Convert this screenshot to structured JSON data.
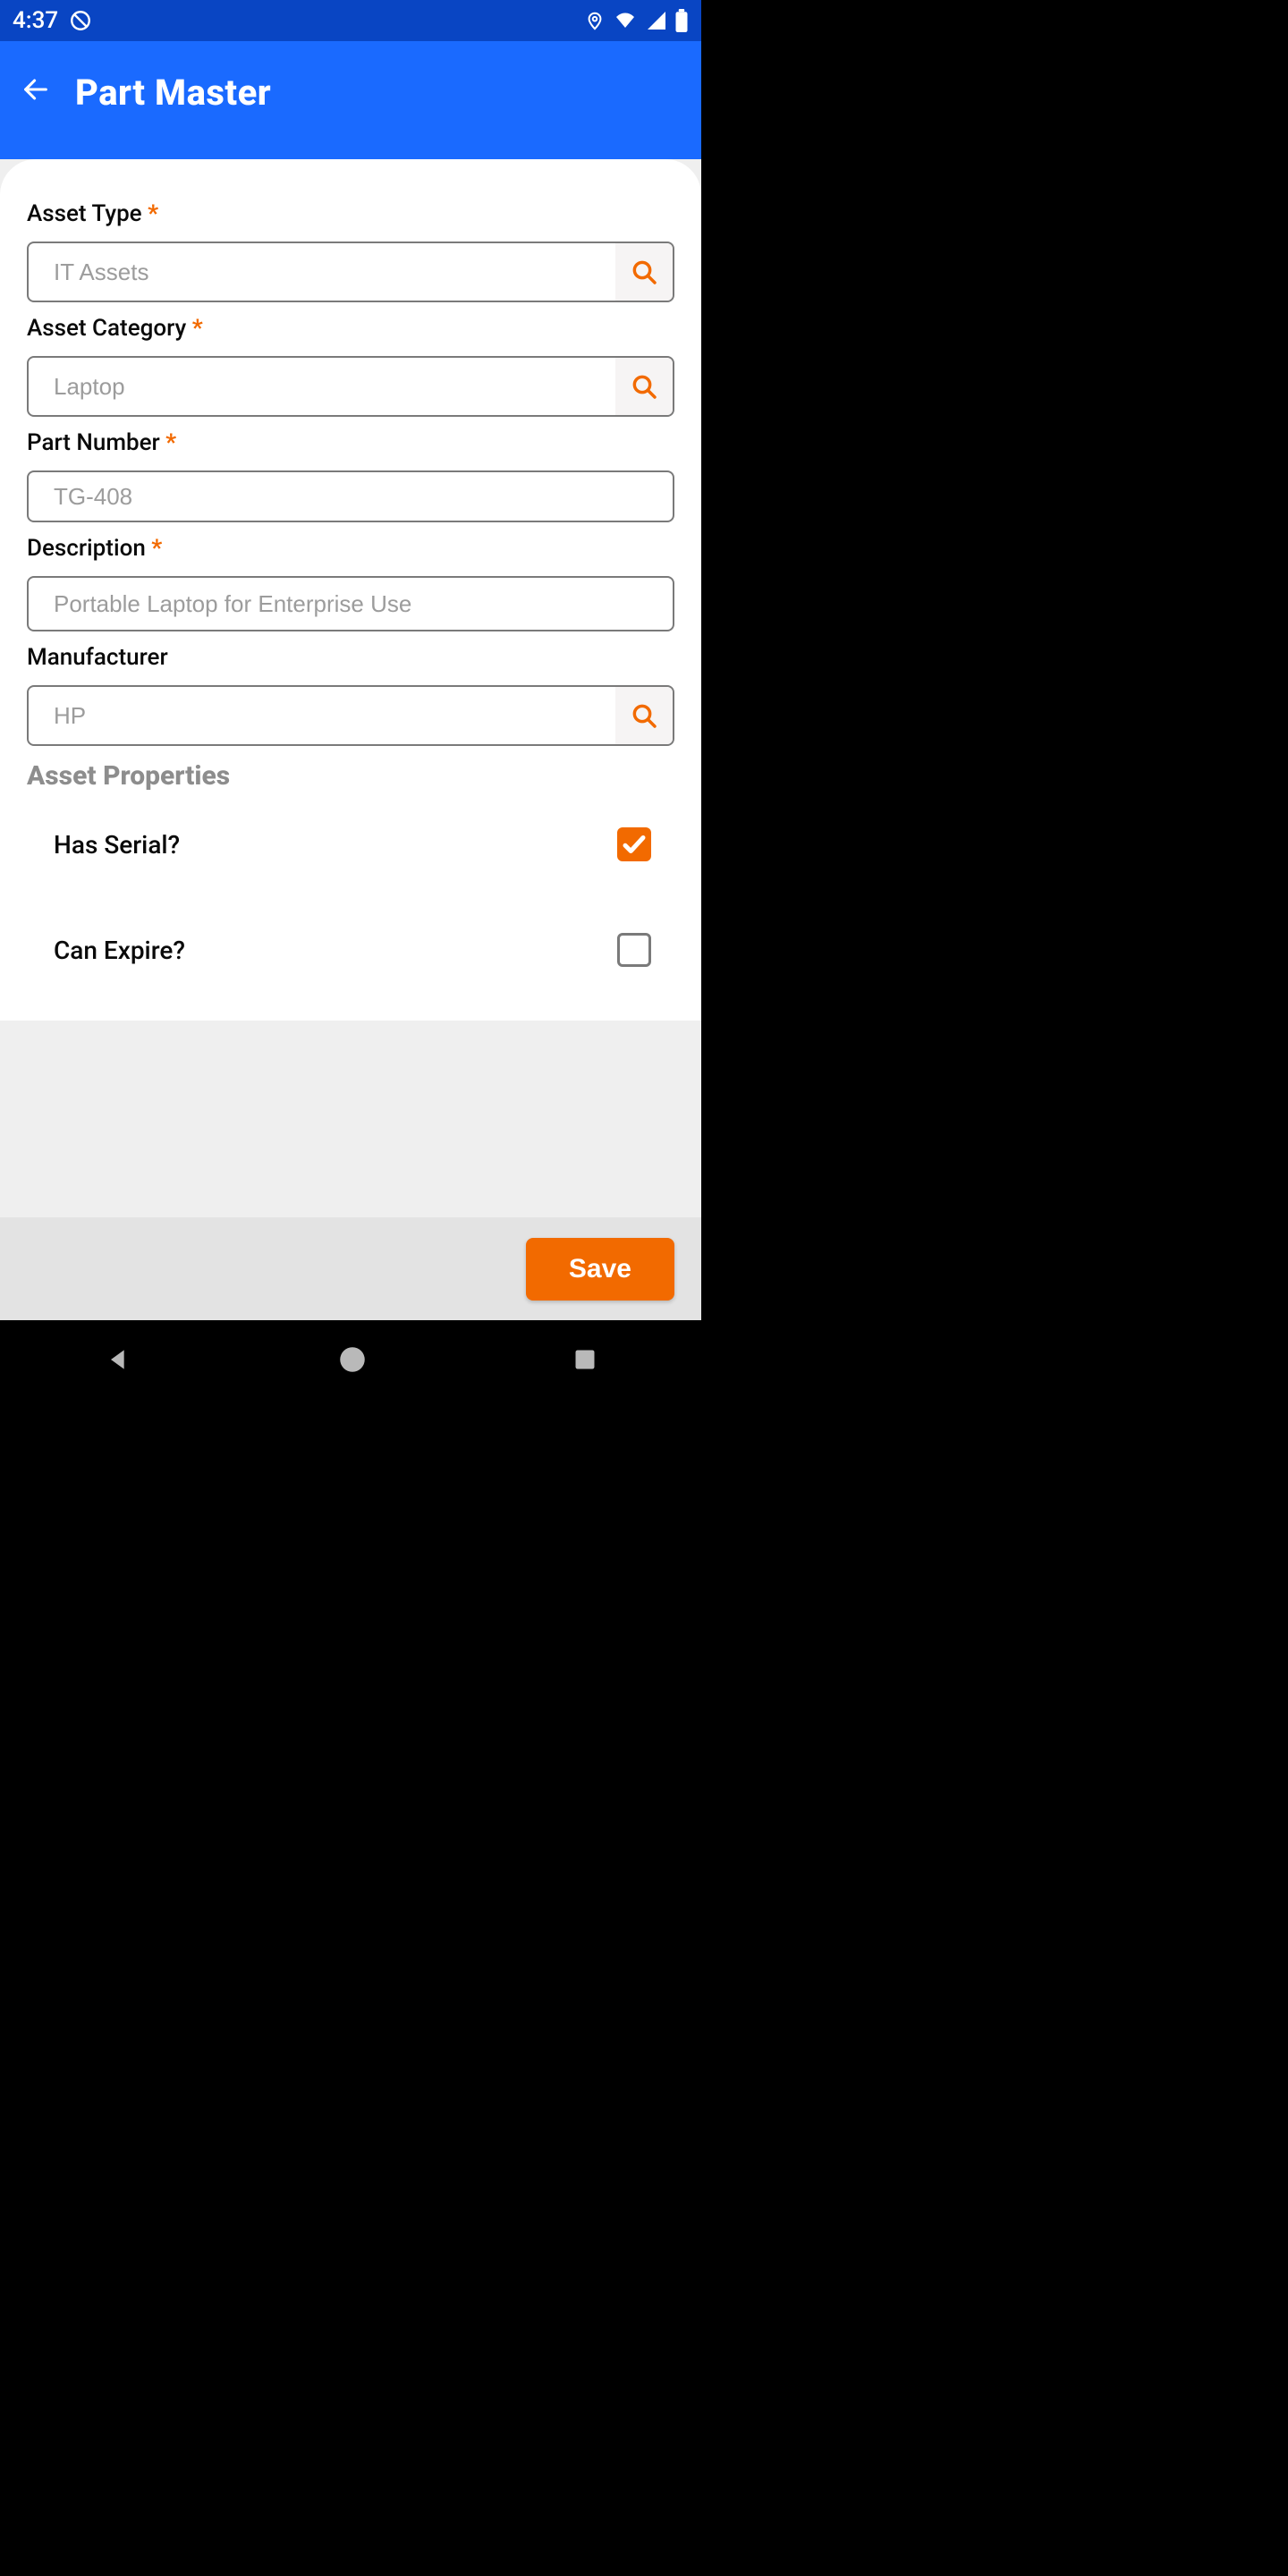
{
  "status": {
    "time": "4:37"
  },
  "header": {
    "title": "Part Master"
  },
  "form": {
    "asset_type": {
      "label": "Asset Type",
      "value": "IT Assets",
      "required": true
    },
    "asset_category": {
      "label": "Asset Category",
      "value": "Laptop",
      "required": true
    },
    "part_number": {
      "label": "Part Number",
      "value": "TG-408",
      "required": true
    },
    "description": {
      "label": "Description",
      "value": "Portable Laptop for Enterprise Use",
      "required": true
    },
    "manufacturer": {
      "label": "Manufacturer",
      "value": "HP",
      "required": false
    }
  },
  "section": {
    "asset_properties": "Asset Properties"
  },
  "props": {
    "has_serial": {
      "label": "Has Serial?",
      "checked": true
    },
    "can_expire": {
      "label": "Can Expire?",
      "checked": false
    }
  },
  "actions": {
    "save": "Save"
  }
}
